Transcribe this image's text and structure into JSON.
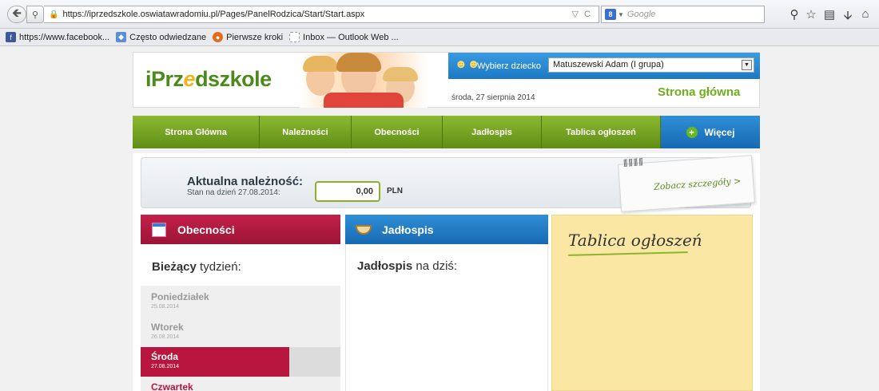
{
  "browser": {
    "url": "https://iprzedszkole.oswiatawradomiu.pl/Pages/PanelRodzica/Start/Start.aspx",
    "search_placeholder": "Google",
    "search_engine_badge": "8"
  },
  "bookmarks": [
    {
      "label": "https://www.facebook...",
      "icon": "facebook-icon",
      "color": "#3b5998"
    },
    {
      "label": "Często odwiedzane",
      "icon": "most-visited-icon",
      "color": "#5b8fd3"
    },
    {
      "label": "Pierwsze kroki",
      "icon": "firefox-icon",
      "color": "#e66a1d"
    },
    {
      "label": "Inbox — Outlook Web ...",
      "icon": "page-icon",
      "color": "#cccccc"
    }
  ],
  "header": {
    "logo_prefix": "iPrz",
    "logo_e": "e",
    "logo_suffix": "dszkole",
    "choose_child_label": "Wybierz dziecko",
    "selected_child": "Matuszewski Adam (I grupa)",
    "date": "środa, 27 sierpnia 2014",
    "page_title": "Strona główna"
  },
  "menu": {
    "items": [
      "Strona Główna",
      "Należności",
      "Obecności",
      "Jadłospis",
      "Tablica ogłoszeń"
    ],
    "more": "Więcej"
  },
  "balance": {
    "title": "Aktualna należność:",
    "subtitle": "Stan na dzień 27.08.2014:",
    "amount": "0,00",
    "currency": "PLN",
    "details_link": "Zobacz szczegóły >"
  },
  "attendance": {
    "title": "Obecności",
    "week_bold": "Bieżący",
    "week_rest": " tydzień:",
    "days": [
      {
        "name": "Poniedziałek",
        "date": "25.08.2014"
      },
      {
        "name": "Wtorek",
        "date": "26.08.2014"
      },
      {
        "name": "Środa",
        "date": "27.08.2014"
      },
      {
        "name": "Czwartek",
        "date": ""
      }
    ]
  },
  "food": {
    "title": "Jadłospis",
    "today_bold": "Jadłospis",
    "today_rest": " na dziś:"
  },
  "board": {
    "title": "Tablica ogłoszeń"
  },
  "colors": {
    "menu_green": "#6f9c1f",
    "blue": "#1c79c4",
    "crimson": "#b8163e",
    "note_yellow": "#fbe7a4"
  }
}
